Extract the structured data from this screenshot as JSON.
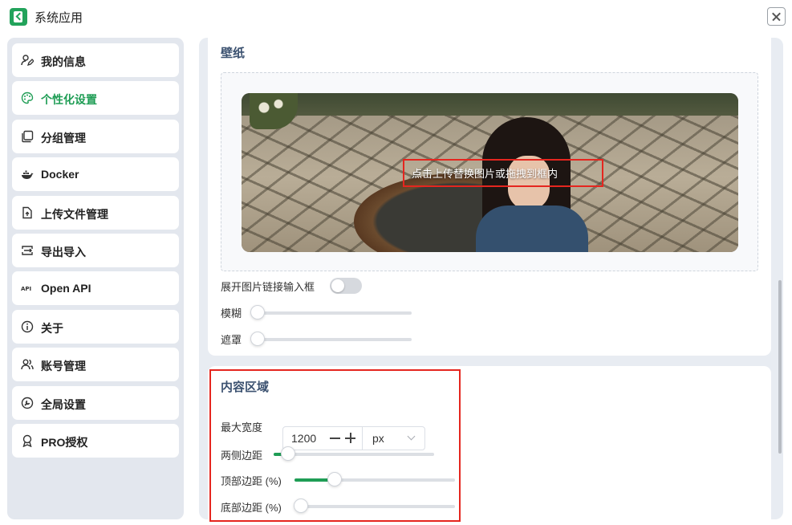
{
  "app": {
    "title": "系统应用"
  },
  "sidebar": {
    "items": [
      {
        "label": "我的信息",
        "icon": "user-edit-icon",
        "active": false
      },
      {
        "label": "个性化设置",
        "icon": "palette-icon",
        "active": true
      },
      {
        "label": "分组管理",
        "icon": "group-copy-icon",
        "active": false
      },
      {
        "label": "Docker",
        "icon": "docker-icon",
        "active": false
      },
      {
        "label": "上传文件管理",
        "icon": "file-upload-icon",
        "active": false
      },
      {
        "label": "导出导入",
        "icon": "import-export-icon",
        "active": false
      },
      {
        "label": "Open API",
        "icon": "api-icon",
        "active": false
      },
      {
        "label": "关于",
        "icon": "info-icon",
        "active": false
      },
      {
        "label": "账号管理",
        "icon": "users-icon",
        "active": false
      },
      {
        "label": "全局设置",
        "icon": "wrench-icon",
        "active": false
      },
      {
        "label": "PRO授权",
        "icon": "award-icon",
        "active": false
      }
    ]
  },
  "wallpaper": {
    "title": "壁纸",
    "upload_hint": "点击上传替换图片或拖拽到框内",
    "show_link_input_label": "展开图片链接输入框",
    "show_link_input_on": false,
    "blur_label": "模糊",
    "blur_value": 0,
    "mask_label": "遮罩",
    "mask_value": 0
  },
  "content_area": {
    "title": "内容区域",
    "max_width_label": "最大宽度",
    "max_width_value": "1200",
    "unit": "px",
    "side_margin_label": "两侧边距",
    "side_margin_fraction": 0.09,
    "top_margin_label": "顶部边距 (%)",
    "top_margin_fraction": 0.25,
    "bottom_margin_label": "底部边距 (%)",
    "bottom_margin_fraction": 0.04
  },
  "colors": {
    "accent": "#1f9d55",
    "annotation": "#e5261f",
    "title": "#3b5170"
  }
}
